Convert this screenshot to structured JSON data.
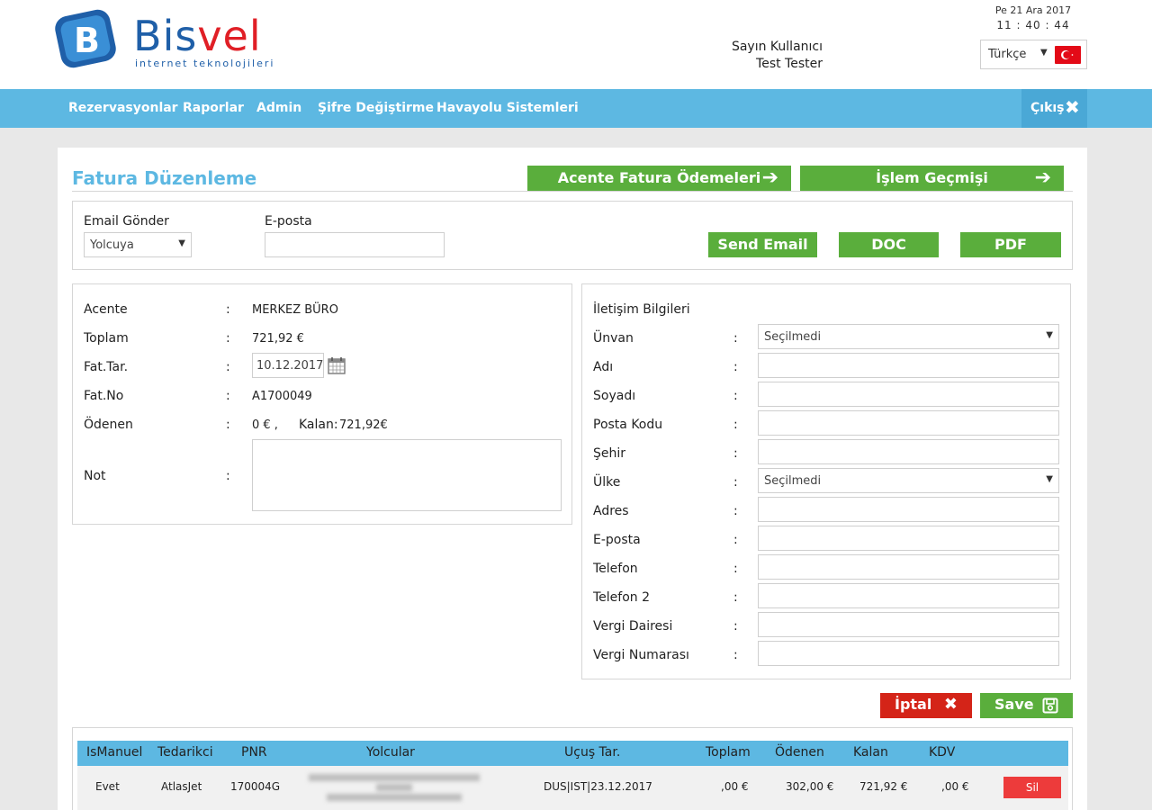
{
  "brand": {
    "name_part1": "B",
    "name_part2": "is",
    "name_part3": "vel",
    "tagline": "internet teknolojileri"
  },
  "header": {
    "greeting": "Sayın Kullanıcı",
    "user_name": "Test Tester",
    "date": "Pe 21 Ara 2017",
    "time": "11 : 40 : 44",
    "language": "Türkçe"
  },
  "nav": {
    "items": [
      "Rezervasyonlar",
      "Raporlar",
      "Admin",
      "Şifre Değiştirme",
      "Havayolu Sistemleri"
    ],
    "logout": "Çıkış"
  },
  "page": {
    "title": "Fatura Düzenleme",
    "btn_agency_payments": "Acente Fatura Ödemeleri",
    "btn_history": "İşlem Geçmişi"
  },
  "email_section": {
    "send_label": "Email Gönder",
    "send_value": "Yolcuya",
    "email_label": "E-posta",
    "email_value": "",
    "btn_send": "Send Email",
    "btn_doc": "DOC",
    "btn_pdf": "PDF"
  },
  "invoice": {
    "colon": ":",
    "agency_label": "Acente",
    "agency_value": "MERKEZ BÜRO",
    "total_label": "Toplam",
    "total_value": "721,92 €",
    "date_label": "Fat.Tar.",
    "date_value": "10.12.2017",
    "no_label": "Fat.No",
    "no_value": "A1700049",
    "paid_label": "Ödenen",
    "paid_value": "0 € ,",
    "remaining_label": "Kalan:",
    "remaining_value": "721,92€",
    "note_label": "Not"
  },
  "contact": {
    "title": "İletişim Bilgileri",
    "fields": [
      {
        "label": "Ünvan",
        "value": "Seçilmedi",
        "type": "select"
      },
      {
        "label": "Adı",
        "value": "",
        "type": "input"
      },
      {
        "label": "Soyadı",
        "value": "",
        "type": "input"
      },
      {
        "label": "Posta Kodu",
        "value": "",
        "type": "input"
      },
      {
        "label": "Şehir",
        "value": "",
        "type": "input"
      },
      {
        "label": "Ülke",
        "value": "Seçilmedi",
        "type": "select"
      },
      {
        "label": "Adres",
        "value": "",
        "type": "input"
      },
      {
        "label": "E-posta",
        "value": "",
        "type": "input"
      },
      {
        "label": "Telefon",
        "value": "",
        "type": "input"
      },
      {
        "label": "Telefon 2",
        "value": "",
        "type": "input"
      },
      {
        "label": "Vergi Dairesi",
        "value": "",
        "type": "input"
      },
      {
        "label": "Vergi Numarası",
        "value": "",
        "type": "input"
      }
    ]
  },
  "actions": {
    "cancel": "İptal",
    "save": "Save"
  },
  "table": {
    "headers": [
      "IsManuel",
      "Tedarikci",
      "PNR",
      "Yolcular",
      "Uçuş Tar.",
      "Toplam",
      "Ödenen",
      "Kalan",
      "KDV"
    ],
    "rows": [
      {
        "is_manual": "Evet",
        "supplier": "AtlasJet",
        "pnr": "170004G",
        "passengers": "",
        "flight": "DUS|IST|23.12.2017",
        "total": ",00 €",
        "paid": "302,00 €",
        "remaining": "721,92 €",
        "vat": ",00 €",
        "delete": "Sil"
      }
    ]
  },
  "colors": {
    "accent": "#5db8e2",
    "green": "#5aae3c",
    "red": "#d42418"
  }
}
